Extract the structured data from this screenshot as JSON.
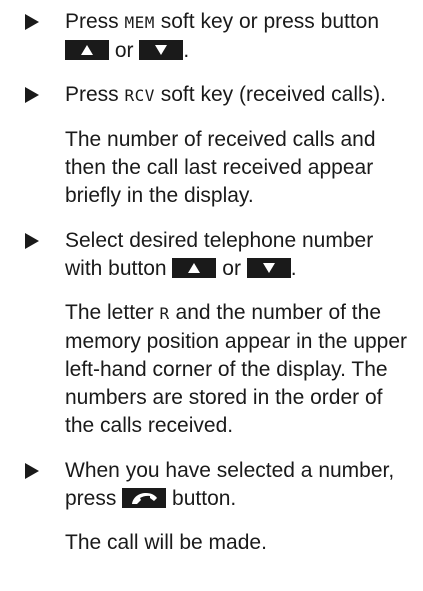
{
  "steps": [
    {
      "pre": "Press ",
      "key": "MEM",
      "mid": " soft key or press button",
      "or": "or",
      "end": "."
    },
    {
      "pre": "Press ",
      "key": "RCV",
      "post": " soft key (received calls).",
      "note": "The number of received calls and then the call last received appear briefly in the display."
    },
    {
      "text": "Select desired telephone number with button",
      "or": "or",
      "end": ".",
      "note_pre": "The letter ",
      "note_key": "R",
      "note_post": " and the number of the memory position appear in the upper left-hand corner of the display. The numbers are stored in the order of the calls received."
    },
    {
      "text": "When you have selected a number, press",
      "post": "button.",
      "note": "The call will be made."
    }
  ],
  "icons": {
    "up": "arrow-up-icon",
    "down": "arrow-down-icon",
    "call": "phone-handset-icon"
  }
}
